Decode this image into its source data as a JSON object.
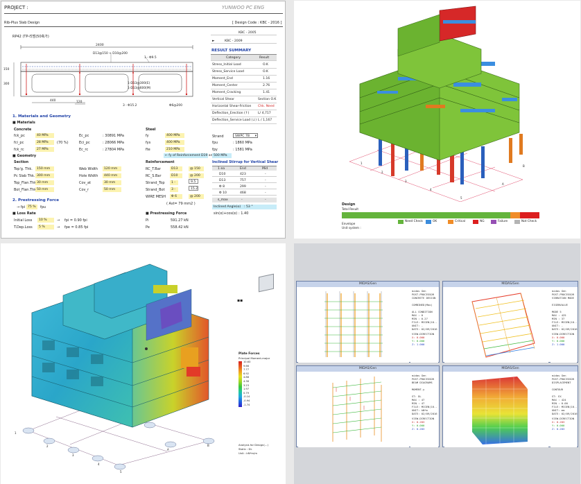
{
  "panel1": {
    "project_label": "PROJECT :",
    "company": "YUNWOO PC ENG",
    "doc_title": "Rib-Plus Slab Design",
    "design_code": "[ Design Code : KBC - 2016 ]",
    "drawing_title": "RP42 (TP-리범(50축가)",
    "dims": {
      "top": "2400",
      "left_h": "150",
      "left_h2": "300",
      "b1": "440",
      "b2": "120",
      "rebar_top": "D13@150 + D10@200",
      "rebar_right": "1 - Φ9.5",
      "stirrup1": "1-D13@300(E)",
      "stirrup2": "1-D13@600(M)",
      "bottom1": "3 - Φ15.2",
      "bottom2": "Φ6@200"
    },
    "code_select": [
      {
        "mark": "",
        "label": "KBC - 2005"
      },
      {
        "mark": "►",
        "label": "KBC - 2009"
      }
    ],
    "result_summary": {
      "title": "RESULT SUMMARY",
      "headers": [
        "Category",
        "Result"
      ],
      "rows": [
        {
          "cat": "Stress_Initial Load",
          "val": "O.K"
        },
        {
          "cat": "Stress_Service Load",
          "val": "O.K"
        },
        {
          "cat": "Moment_End",
          "val": "1.16"
        },
        {
          "cat": "Moment_Center",
          "val": "2.76"
        },
        {
          "cat": "Moment_Cracking",
          "val": "1.41"
        },
        {
          "cat": "Vertical Shear",
          "val": "Section O.K"
        },
        {
          "cat": "Horizontal Shear-Friction",
          "val": "Chk. Need"
        },
        {
          "cat": "Deflection_Erection (↑)",
          "val": "L/ 4,717"
        },
        {
          "cat": "Deflection_Service Load (↓)",
          "val": "L / 1,167"
        }
      ]
    },
    "section1": "1. Materials and Geometry",
    "materials_title": "■ Materials",
    "concrete_title": "Concrete",
    "concrete": [
      {
        "label": "fck_pc",
        "val": "40 MPa",
        "extra": "",
        "elabel": "Ec_pc",
        "eval": ": 30891 MPa"
      },
      {
        "label": "fci_pc",
        "val": "28 MPa",
        "extra": "(70 %)",
        "elabel": "Eci_pc",
        "eval": ": 28066 MPa"
      },
      {
        "label": "fck_rc",
        "val": "27 MPa",
        "extra": "",
        "elabel": "Ec_rc",
        "eval": ": 27804 MPa"
      }
    ],
    "steel_title": "Steel",
    "steel": [
      {
        "label": "fy",
        "val": "400 MPa"
      },
      {
        "label": "fys",
        "val": "400 MPa"
      },
      {
        "label": "fte",
        "val": "210 MPa"
      }
    ],
    "steel_note": "← fy of Reinforcement D19 and Larger",
    "steel_note_val": "500 MPa",
    "strand": {
      "label": "Strand",
      "val": "SWPC 7B",
      "fpu_label": "fpu",
      "fpu": ": 1860 MPa",
      "fpy_label": "fpy",
      "fpy": ": 1581 MPa"
    },
    "geometry_title": "■ Geometry",
    "section_title": "Section",
    "section": [
      {
        "label": "Top'g. Thk.",
        "val": "150 mm",
        "wlabel": "Web Width",
        "wval": "120 mm"
      },
      {
        "label": "Pc Slab Thk.",
        "val": "300 mm",
        "wlabel": "Hole Width",
        "wval": "440 mm"
      },
      {
        "label": "Top_Flan.Thk.",
        "val": "30 mm",
        "wlabel": "Cov_at",
        "wval": "30 mm"
      },
      {
        "label": "Bot_Flan.Thk.",
        "val": "50 mm",
        "wlabel": "Cov_r",
        "wval": "50 mm"
      }
    ],
    "reinf_title": "Reinforcement",
    "reinf": [
      {
        "label": "RC_T.Bar",
        "a": "D13",
        "b": "@ 150"
      },
      {
        "label": "RC_S.Bar",
        "a": "D10",
        "b": "@ 200"
      },
      {
        "label": "Strand_Top",
        "a": "1 -",
        "b": "9.5"
      },
      {
        "label": "Strand_Bot",
        "a": "3 -",
        "b": "15.2"
      },
      {
        "label": "WIRE MESH",
        "a": "Φ 6",
        "b": "@ 200"
      }
    ],
    "reinf_note": "( Ast= 79 mm2 )",
    "inclined_title": "Inclined Stirrup for Vertical Shear",
    "inclined_headers": [
      "1 ea",
      "End",
      "Mid"
    ],
    "inclined_rows": [
      {
        "a": "D10",
        "b": "423",
        "c": "-"
      },
      {
        "a": "D13",
        "b": "757",
        "c": "-"
      },
      {
        "a": "Φ 8",
        "b": "299",
        "c": "-"
      },
      {
        "a": "Φ 10",
        "b": "468",
        "c": "-"
      }
    ],
    "smax": {
      "label": "s_max",
      "b": "-",
      "c": "-"
    },
    "angle": {
      "label": "Inclined Angle(α)",
      "val": ": 53 °"
    },
    "sincos": {
      "label": "sin(α)+cos(α)",
      "val": ":  1.40"
    },
    "section2": "2. Prestressing Force",
    "fpi": {
      "label": "→ fpi :",
      "val": "75 %",
      "unit": "fpu"
    },
    "loss_title": "■ Loss Rate",
    "loss": [
      {
        "label": "Initial Loss",
        "val": "10 %",
        "arrow": "→",
        "res": "fpi = 0.90 fpi"
      },
      {
        "label": "T.Dep.Loss",
        "val": "5 %",
        "arrow": "→",
        "res": "fpe = 0.85 fpi"
      }
    ],
    "pf_title": "■ Prestressing Force",
    "pf": [
      {
        "label": "Pi",
        "val": "591.27 kN"
      },
      {
        "label": "Pe",
        "val": "558.42 kN"
      }
    ]
  },
  "panel2": {
    "design_label": "Design",
    "total_result": "Total Result",
    "envelope": "Envelope",
    "unit_system": "Unit system :",
    "legend": [
      {
        "label": "Need Check",
        "color": "#64b43c"
      },
      {
        "label": "OK",
        "color": "#3c8cdc"
      },
      {
        "label": "Critical",
        "color": "#f08c28"
      },
      {
        "label": "NG",
        "color": "#dc1e1e"
      },
      {
        "label": "Failure",
        "color": "#9650b4"
      },
      {
        "label": "Not Check",
        "color": "#b4b4b4"
      }
    ],
    "grid_labels": [
      "1",
      "2",
      "3",
      "4",
      "5",
      "6",
      "A",
      "B",
      "C",
      "D",
      "E"
    ]
  },
  "panel3": {
    "plate_forces": "Plate Forces",
    "subtitle": "Principal Moment-major",
    "scale": [
      "10.63",
      "9.66",
      "7.77",
      "6.92",
      "4.88",
      "4.36",
      "3.23",
      "1.97",
      "0.79",
      "-0.14",
      "-0.94",
      "-1.74"
    ],
    "footer": [
      "Analysis for Design(...)",
      "Static : DL",
      "Unit : kN*m/m"
    ],
    "grid_labels": [
      "1",
      "2",
      "3",
      "4",
      "5",
      "6",
      "A",
      "B",
      "C",
      "D",
      "E"
    ],
    "top_mark": "▪▪"
  },
  "panel4": {
    "windows": [
      {
        "title": "MIDAS/Gen",
        "info": [
          "midas Gen",
          "POST-PROCESSOR",
          "CONCRETE DESIGN",
          "",
          "COMBINED(Max)",
          "",
          "ALL CONDITION",
          "MAX : 0",
          "MIN : 0.27",
          "FILE: MCGEN(10..",
          "UNIT: -",
          "DATE: 02/09/2016",
          "VIEW-DIRECTION",
          "X: 0.000",
          "Y: 0.000",
          "Z: 1.000"
        ]
      },
      {
        "title": "MIDAS/Gen",
        "info": [
          "midas Gen",
          "POST-PROCESSOR",
          "VIBRATION MODE",
          "",
          "EIGENVALUE",
          "",
          "MODE 5",
          "MAX : 425",
          "MIN : 37",
          "FILE: MCGEN(10..",
          "UNIT: -",
          "DATE: 02/09/2016",
          "VIEW-DIRECTION",
          "X: 0.000",
          "Y: 0.000",
          "Z: 1.000"
        ]
      },
      {
        "title": "MIDAS/Gen",
        "info": [
          "midas Gen",
          "POST-PROCESSOR",
          "BEAM DIAGRAMS",
          "",
          "MOMENT-y",
          "",
          "ST: DL",
          "MAX : 47",
          "MIN : 47",
          "FILE: MCGEN(10..",
          "UNIT: kN*m",
          "DATE: 02/09/2016",
          "VIEW-DIRECTION",
          "X: 0.283",
          "Y: 0.000",
          "Z: 0.283"
        ]
      },
      {
        "title": "MIDAS/Gen",
        "info": [
          "midas Gen",
          "POST-PROCESSOR",
          "DISPLACEMENT",
          "",
          "CONTOUR",
          "",
          "ST: EX",
          "MAX : 424",
          "MIN : 0.00",
          "FILE: MCGEN(10..",
          "UNIT: mm",
          "DATE: 02/09/2016",
          "VIEW-DIRECTION",
          "X: 0.283",
          "Y: 0.000",
          "Z: 0.283"
        ]
      }
    ]
  }
}
